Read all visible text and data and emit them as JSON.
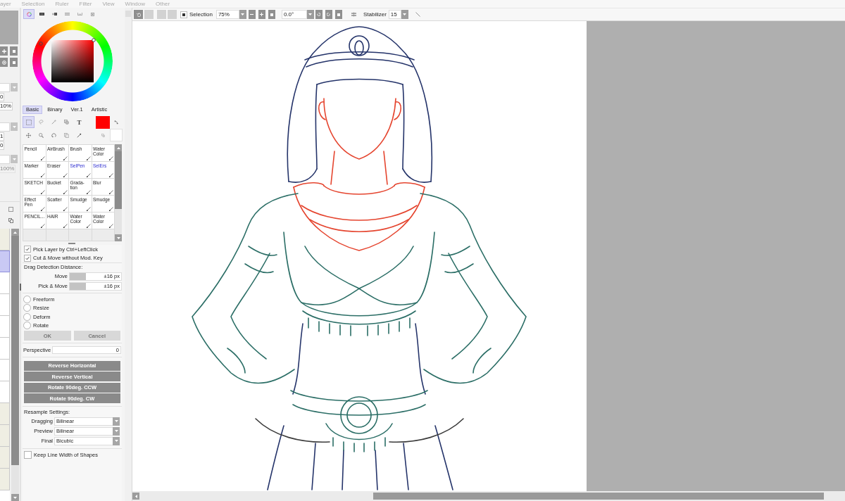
{
  "menu": [
    "ayer",
    "Selection",
    "Ruler",
    "Filter",
    "View",
    "Window",
    "Other"
  ],
  "layer_panel": {
    "field_groups": [
      [
        {
          "kind": "dropdown"
        },
        {
          "kind": "value",
          "text": "0",
          "disabled": false
        },
        {
          "kind": "value",
          "text": "10%",
          "disabled": false
        }
      ],
      [
        {
          "kind": "dropdown"
        },
        {
          "kind": "value",
          "text": "1",
          "disabled": false
        },
        {
          "kind": "value",
          "text": "0",
          "disabled": false
        }
      ],
      [
        {
          "kind": "dropdown"
        },
        {
          "kind": "value",
          "text": "100%",
          "disabled": true
        }
      ]
    ],
    "layers": [
      {
        "selected": false,
        "color": "#efeee3"
      },
      {
        "selected": true
      },
      {
        "selected": false,
        "color": "#ffffff"
      },
      {
        "selected": false,
        "color": "#ffffff"
      },
      {
        "selected": false,
        "color": "#ffffff"
      },
      {
        "selected": false,
        "color": "#ffffff"
      },
      {
        "selected": false,
        "color": "#ffffff"
      },
      {
        "selected": false,
        "color": "#ffffff"
      },
      {
        "selected": false,
        "color": "#efeee3"
      },
      {
        "selected": false,
        "color": "#efeee3"
      },
      {
        "selected": false,
        "color": "#efeee3"
      },
      {
        "selected": false,
        "color": "#efeee3"
      }
    ]
  },
  "color_panel": {
    "modes": [
      {
        "selected": true
      },
      {
        "selected": false
      },
      {
        "selected": false
      },
      {
        "selected": false
      },
      {
        "selected": false
      },
      {
        "selected": false
      }
    ],
    "tabs": [
      {
        "label": "Basic",
        "selected": true
      },
      {
        "label": "Binary",
        "selected": false
      },
      {
        "label": "Ver.1",
        "selected": false
      },
      {
        "label": "Artistic",
        "selected": false
      }
    ],
    "tools": [
      {
        "selected": true
      },
      {
        "selected": false
      },
      {
        "selected": false
      },
      {
        "selected": false
      },
      {
        "label": "T",
        "selected": false
      },
      {
        "selected": false
      },
      {
        "selected": false
      },
      {
        "selected": false
      },
      {
        "selected": false
      },
      {
        "selected": false
      }
    ],
    "swatches": [
      {
        "color": "#ff0000"
      },
      {
        "color": "#ffffff"
      }
    ]
  },
  "brushes": [
    {
      "name": "Pencil",
      "kind": "brush"
    },
    {
      "name": "AirBrush",
      "kind": "brush"
    },
    {
      "name": "Brush",
      "kind": "brush"
    },
    {
      "name": "Water Color",
      "kind": "brush"
    },
    {
      "name": "Marker",
      "kind": "brush"
    },
    {
      "name": "Eraser",
      "kind": "brush"
    },
    {
      "name": "SelPen",
      "kind": "selection"
    },
    {
      "name": "SelErs",
      "kind": "selection"
    },
    {
      "name": "SKETCH",
      "kind": "brush"
    },
    {
      "name": "Bucket",
      "kind": "brush"
    },
    {
      "name": "Grada-tion",
      "kind": "brush"
    },
    {
      "name": "Blur",
      "kind": "brush"
    },
    {
      "name": "Effect Pen",
      "kind": "brush"
    },
    {
      "name": "Scatter",
      "kind": "brush"
    },
    {
      "name": "Smudge",
      "kind": "brush"
    },
    {
      "name": "Smudge",
      "kind": "brush"
    },
    {
      "name": "PENCIL...",
      "kind": "brush"
    },
    {
      "name": "HAIR",
      "kind": "brush"
    },
    {
      "name": "Water Color",
      "kind": "brush"
    },
    {
      "name": "Water Color",
      "kind": "brush"
    }
  ],
  "options": {
    "checkboxes": [
      {
        "label": "Pick Layer by Ctrl+LeftClick",
        "checked": true
      },
      {
        "label": "Cut & Move without Mod. Key",
        "checked": true
      }
    ],
    "drag_title": "Drag Detection Distance:",
    "sliders": [
      {
        "label": "Move",
        "level": 0.32,
        "reading": "±16 px"
      },
      {
        "label": "Pick & Move",
        "level": 0.32,
        "reading": "±16 px"
      }
    ],
    "transforms": [
      {
        "label": "Freeform",
        "selected": false
      },
      {
        "label": "Resize",
        "selected": false
      },
      {
        "label": "Deform",
        "selected": false
      },
      {
        "label": "Rotate",
        "selected": false
      }
    ],
    "buttons": [
      {
        "label": "OK",
        "disabled": true
      },
      {
        "label": "Cancel",
        "disabled": true
      }
    ],
    "perspective": {
      "label": "Perspective",
      "value": "0"
    },
    "actions": [
      "Reverse Horizontal",
      "Reverse Vertical",
      "Rotate 90deg. CCW",
      "Rotate 90deg. CW"
    ],
    "resample_title": "Resample Settings:",
    "resample": [
      {
        "label": "Dragging",
        "value": "Bilinear"
      },
      {
        "label": "Preview",
        "value": "Bilinear"
      },
      {
        "label": "Final",
        "value": "Bicubic"
      }
    ],
    "keep_line_width": {
      "label": "Keep Line Width of Shapes",
      "checked": false
    }
  },
  "toolbar": {
    "buttons": [
      {
        "disabled": false
      },
      {
        "disabled": true
      },
      {
        "disabled": true
      },
      {
        "disabled": true
      }
    ],
    "selection": {
      "label": "Selection",
      "checked": true
    },
    "zoom": "75%",
    "angle": "0.0°",
    "stabilizer": {
      "label": "Stabilizer",
      "value": "15"
    }
  }
}
